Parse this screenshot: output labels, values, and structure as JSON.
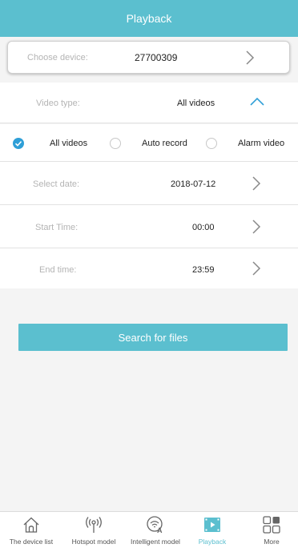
{
  "header": {
    "title": "Playback"
  },
  "device": {
    "label": "Choose device:",
    "value": "27700309"
  },
  "video_type": {
    "label": "Video type:",
    "value": "All videos",
    "options": [
      {
        "label": "All videos",
        "selected": true
      },
      {
        "label": "Auto record",
        "selected": false
      },
      {
        "label": "Alarm video",
        "selected": false
      }
    ]
  },
  "date": {
    "label": "Select date:",
    "value": "2018-07-12"
  },
  "start_time": {
    "label": "Start Time:",
    "value": "00:00"
  },
  "end_time": {
    "label": "End time:",
    "value": "23:59"
  },
  "search": {
    "label": "Search for files"
  },
  "tabbar": {
    "items": [
      {
        "label": "The device list",
        "icon": "home-icon",
        "active": false
      },
      {
        "label": "Hotspot model",
        "icon": "hotspot-icon",
        "active": false
      },
      {
        "label": "Intelligent model",
        "icon": "wifi-a-icon",
        "active": false
      },
      {
        "label": "Playback",
        "icon": "playback-icon",
        "active": true
      },
      {
        "label": "More",
        "icon": "grid-icon",
        "active": false
      }
    ]
  },
  "colors": {
    "accent": "#5bbfcf",
    "check": "#2f9fd7",
    "background": "#f4f4f4"
  }
}
